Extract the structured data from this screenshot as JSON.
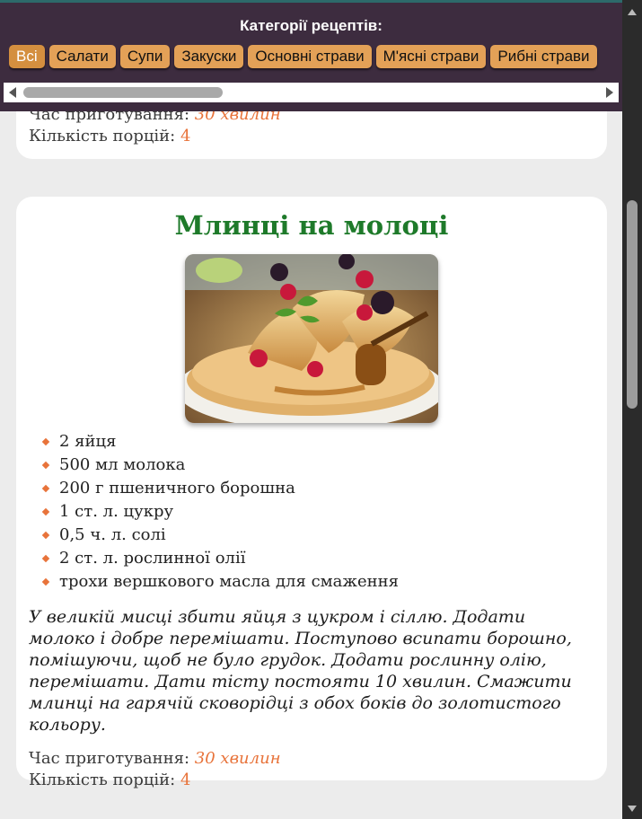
{
  "categories": {
    "title": "Категорії рецептів:",
    "items": [
      "Всі",
      "Салати",
      "Супи",
      "Закуски",
      "Основні страви",
      "М'ясні страви",
      "Рибні страви"
    ],
    "active_index": 0
  },
  "previous_card": {
    "time_label": "Час приготування:",
    "time_value": "30 хвилин",
    "servings_label": "Кількість порцій:",
    "servings_value": "4"
  },
  "recipe": {
    "title": "Млинці на молоці",
    "image_alt": "pancakes-with-berries-and-honey",
    "ingredients": [
      "2 яйця",
      "500 мл молока",
      "200 г пшеничного борошна",
      "1 ст. л. цукру",
      "0,5 ч. л. солі",
      "2 ст. л. рослинної олії",
      "трохи вершкового масла для смаження"
    ],
    "instructions": "У великій мисці збити яйця з цукром і сіллю. Додати молоко і добре перемішати. Поступово всипати борошно, помішуючи, щоб не було грудок. Додати рослинну олію, перемішати. Дати тісту постояти 10 хвилин. Смажити млинці на гарячій сковорідці з обох боків до золотистого кольору.",
    "time_label": "Час приготування:",
    "time_value": "30 хвилин",
    "servings_label": "Кількість порцій:",
    "servings_value": "4"
  },
  "colors": {
    "title_green": "#1e7a2a",
    "accent_orange": "#e8733a",
    "header_bg": "#3d2c3f",
    "button_bg": "#e3a157"
  }
}
